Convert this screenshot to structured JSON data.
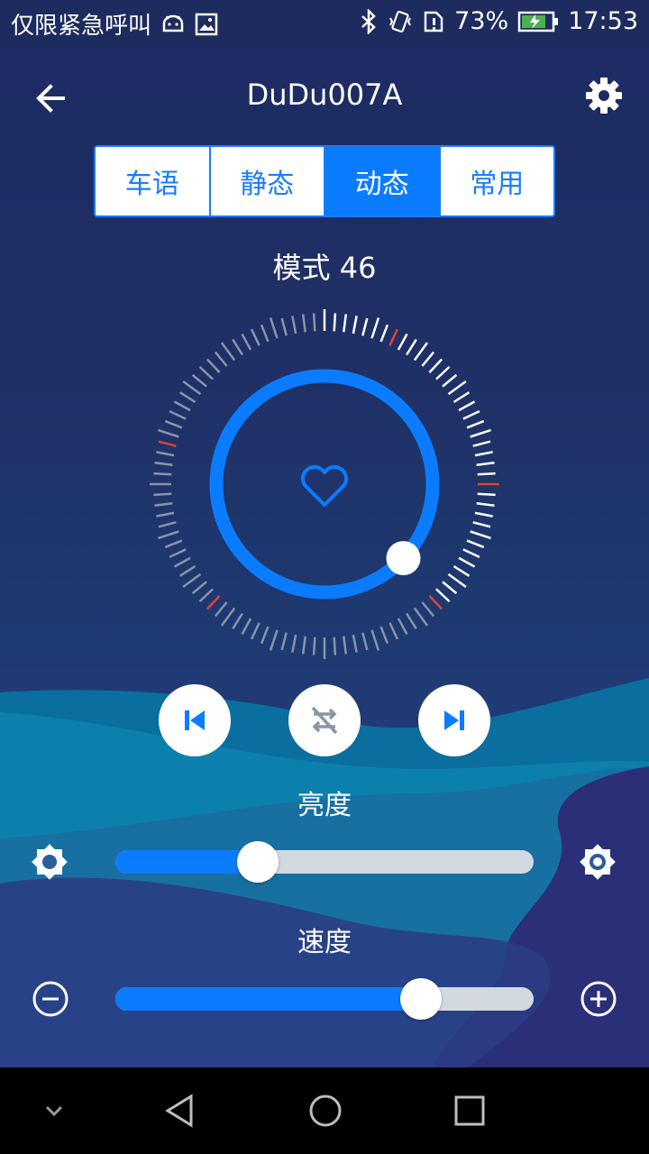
{
  "status_bar": {
    "notification_text": "仅限紧急呼叫",
    "battery": "73%",
    "time": "17:53"
  },
  "header": {
    "title": "DuDu007A"
  },
  "tabs": [
    {
      "label": "车语",
      "active": false
    },
    {
      "label": "静态",
      "active": false
    },
    {
      "label": "动态",
      "active": true
    },
    {
      "label": "常用",
      "active": false
    }
  ],
  "mode": {
    "label": "模式 46",
    "dial_position_fraction": 0.37
  },
  "controls": {
    "previous_icon": "skip-previous-icon",
    "shuffle_off_icon": "shuffle-off-icon",
    "next_icon": "skip-next-icon"
  },
  "brightness": {
    "label": "亮度",
    "value_fraction": 0.34
  },
  "speed": {
    "label": "速度",
    "value_fraction": 0.73
  },
  "colors": {
    "accent": "#0b7cff",
    "background": "#1f3066",
    "tick_red": "#e0433b"
  }
}
